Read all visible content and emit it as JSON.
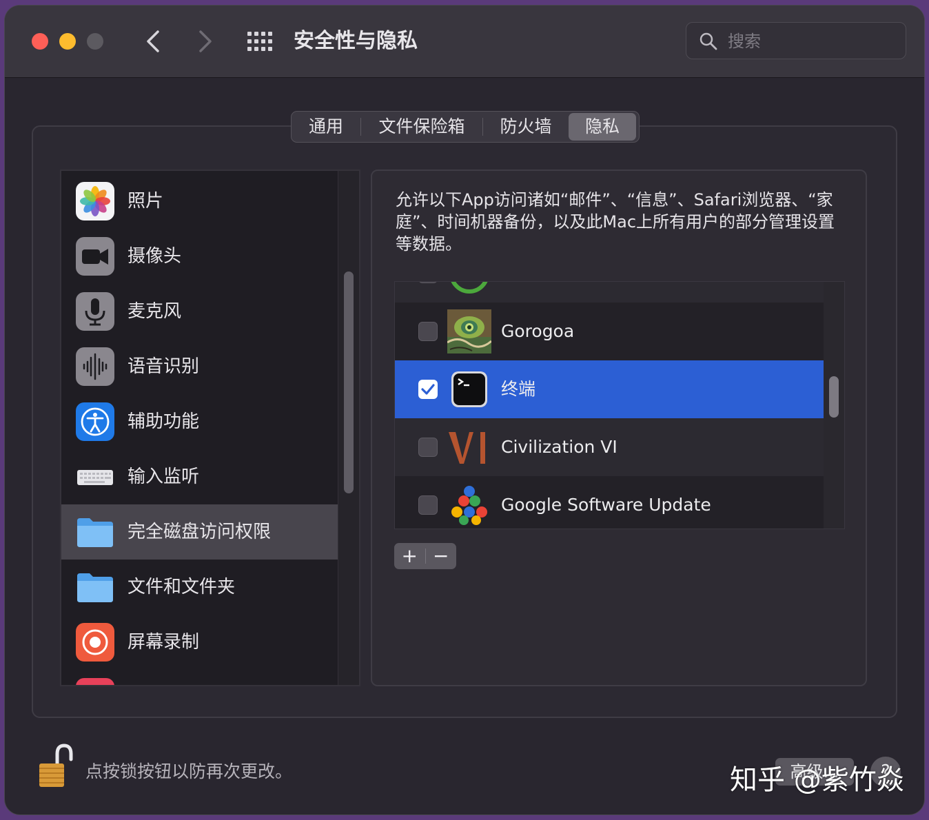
{
  "window": {
    "title": "安全性与隐私",
    "search_placeholder": "搜索"
  },
  "tabs": [
    {
      "label": "通用",
      "selected": false
    },
    {
      "label": "文件保险箱",
      "selected": false
    },
    {
      "label": "防火墙",
      "selected": false
    },
    {
      "label": "隐私",
      "selected": true
    }
  ],
  "sidebar": {
    "items": [
      {
        "label": "照片",
        "icon": "photos-icon"
      },
      {
        "label": "摄像头",
        "icon": "camera-icon"
      },
      {
        "label": "麦克风",
        "icon": "microphone-icon"
      },
      {
        "label": "语音识别",
        "icon": "speech-recognition-icon"
      },
      {
        "label": "辅助功能",
        "icon": "accessibility-icon"
      },
      {
        "label": "输入监听",
        "icon": "keyboard-icon"
      },
      {
        "label": "完全磁盘访问权限",
        "icon": "folder-icon",
        "selected": true
      },
      {
        "label": "文件和文件夹",
        "icon": "folder-icon"
      },
      {
        "label": "屏幕录制",
        "icon": "screen-recording-icon"
      }
    ]
  },
  "detail": {
    "description": "允许以下App访问诸如“邮件”、“信息”、Safari浏览器、“家庭”、时间机器备份，以及此Mac上所有用户的部分管理设置等数据。",
    "apps": [
      {
        "name": "Gorogoa",
        "checked": false,
        "icon": "gorogoa-icon"
      },
      {
        "name": "终端",
        "checked": true,
        "icon": "terminal-icon",
        "selected": true
      },
      {
        "name": "Civilization VI",
        "checked": false,
        "icon": "civilization-icon"
      },
      {
        "name": "Google Software Update",
        "checked": false,
        "icon": "google-update-icon"
      }
    ],
    "add_label": "+",
    "remove_label": "−"
  },
  "footer": {
    "lock_text": "点按锁按钮以防再次更改。",
    "advanced_label": "高级...",
    "help_label": "?"
  },
  "watermark": "知乎 @紫竹焱",
  "colors": {
    "selection_blue": "#2c5fd4",
    "window_bg": "#29262f"
  }
}
